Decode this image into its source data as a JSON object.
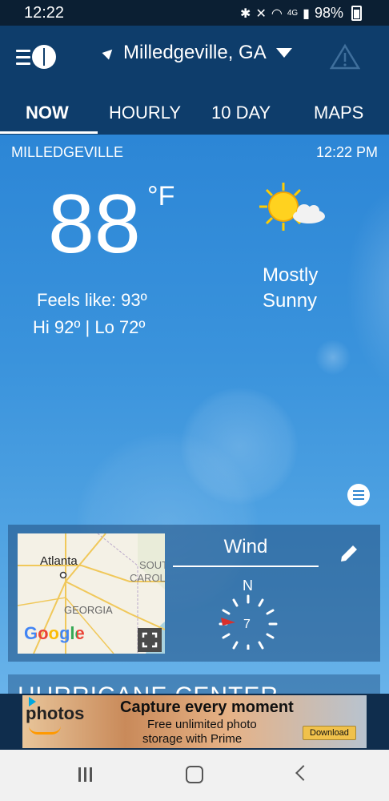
{
  "status_bar": {
    "time": "12:22",
    "network": "4G",
    "battery": "98%"
  },
  "header": {
    "location": "Milledgeville, GA"
  },
  "tabs": [
    {
      "label": "NOW"
    },
    {
      "label": "HOURLY"
    },
    {
      "label": "10 DAY"
    },
    {
      "label": "MAPS"
    }
  ],
  "current": {
    "city": "MILLEDGEVILLE",
    "time": "12:22 PM",
    "temperature": "88",
    "unit": "°F",
    "feels_like": "Feels like: 93º",
    "hi_lo": "Hi 92º | Lo 72º",
    "condition_line1": "Mostly",
    "condition_line2": "Sunny",
    "condition_icon": "partly-sunny-icon"
  },
  "map_card": {
    "labels": {
      "atlanta": "Atlanta",
      "georgia": "GEORGIA",
      "sc1": "SOUT",
      "sc2": "CAROL"
    },
    "google": "Google"
  },
  "wind_card": {
    "title": "Wind",
    "direction": "N",
    "speed": "7"
  },
  "next_card": {
    "title": "HURRICANE CENTER"
  },
  "ad": {
    "brand": "photos",
    "headline": "Capture every moment",
    "sub1": "Free unlimited photo",
    "sub2": "storage with Prime",
    "button": "Download"
  },
  "colors": {
    "header": "#0e3d6b",
    "sky": "#3a93dc",
    "sun": "#ffd21f"
  }
}
